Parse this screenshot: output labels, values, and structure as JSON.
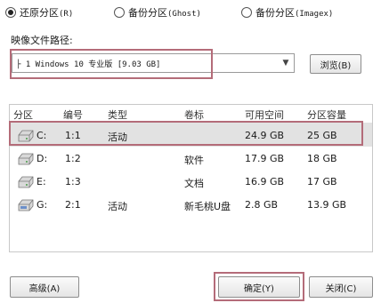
{
  "radios": [
    {
      "label": "还原分区",
      "hint": "(R)",
      "checked": true
    },
    {
      "label": "备份分区",
      "hint": "(Ghost)",
      "checked": false
    },
    {
      "label": "备份分区",
      "hint": "(Imagex)",
      "checked": false
    }
  ],
  "image_path": {
    "label": "映像文件路径:",
    "value": "├ 1 Windows 10 专业版 [9.03 GB]",
    "browse_label": "浏览(B)"
  },
  "table": {
    "columns": [
      "分区",
      "编号",
      "类型",
      "卷标",
      "可用空间",
      "分区容量"
    ],
    "rows": [
      {
        "drive": "C:",
        "id": "1:1",
        "type": "活动",
        "label": "",
        "free": "24.9 GB",
        "size": "25 GB",
        "icon": "hard-disk-icon",
        "selected": true
      },
      {
        "drive": "D:",
        "id": "1:2",
        "type": "",
        "label": "软件",
        "free": "17.9 GB",
        "size": "18 GB",
        "icon": "hard-disk-icon",
        "selected": false
      },
      {
        "drive": "E:",
        "id": "1:3",
        "type": "",
        "label": "文档",
        "free": "16.9 GB",
        "size": "17 GB",
        "icon": "hard-disk-icon",
        "selected": false
      },
      {
        "drive": "G:",
        "id": "2:1",
        "type": "活动",
        "label": "新毛桃U盘",
        "free": "2.8 GB",
        "size": "13.9 GB",
        "icon": "usb-disk-icon",
        "selected": false
      }
    ]
  },
  "buttons": {
    "advanced": "高级(A)",
    "ok": "确定(Y)",
    "close": "关闭(C)"
  },
  "colors": {
    "highlight": "#b46c79",
    "selected_row": "#e2e2e2"
  }
}
